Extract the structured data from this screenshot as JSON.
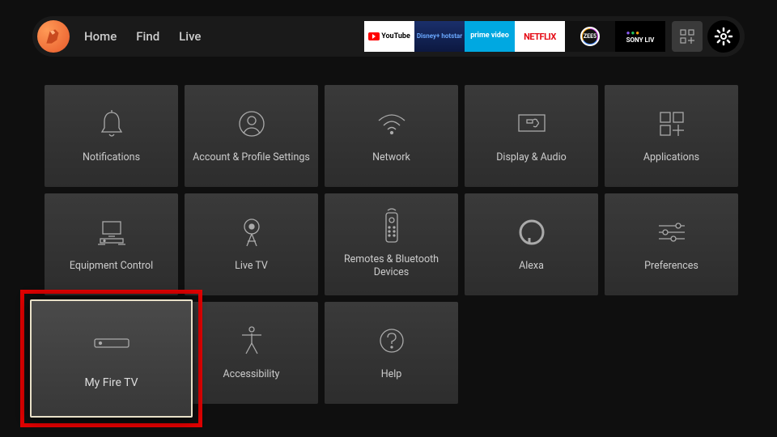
{
  "nav": {
    "links": [
      "Home",
      "Find",
      "Live"
    ]
  },
  "apps": [
    {
      "name": "youtube",
      "label": "YouTube"
    },
    {
      "name": "disney",
      "label": "Disney+ hotstar"
    },
    {
      "name": "prime",
      "label": "prime video"
    },
    {
      "name": "netflix",
      "label": "NETFLIX"
    },
    {
      "name": "zee5",
      "label": "ZEE5"
    },
    {
      "name": "sonyliv",
      "label": "SONY LIV"
    }
  ],
  "tiles": {
    "notifications": "Notifications",
    "account": "Account & Profile Settings",
    "network": "Network",
    "display": "Display & Audio",
    "applications": "Applications",
    "equipment": "Equipment Control",
    "livetv": "Live TV",
    "remotes": "Remotes & Bluetooth Devices",
    "alexa": "Alexa",
    "preferences": "Preferences",
    "myfiretv": "My Fire TV",
    "accessibility": "Accessibility",
    "help": "Help"
  },
  "selected": "myfiretv"
}
